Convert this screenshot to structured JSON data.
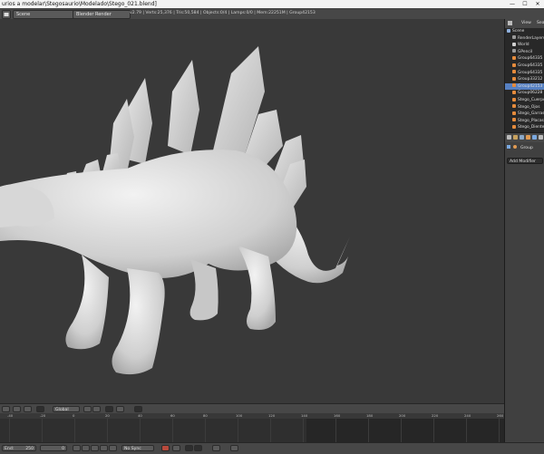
{
  "window": {
    "title": "urios a modelar\\Stegosaurio\\Modelado\\Stego_021.blend]",
    "controls": [
      "—",
      "☐",
      "✕"
    ]
  },
  "topbar": {
    "scene": "Scene",
    "render_engine": "Blender Render",
    "stats": "v2.79 | Verts:25,376 | Tris:50,584 | Objects:0/4 | Lamps:0/0 | Mem:22251M | Group42153"
  },
  "outliner": {
    "headers": [
      "View",
      "Search"
    ],
    "items": [
      {
        "label": "Scene",
        "color": "#8fb0dd"
      },
      {
        "label": "RenderLayers",
        "color": "#9a9a9a"
      },
      {
        "label": "World",
        "color": "#d0d0d0"
      },
      {
        "label": "GPencil",
        "color": "#9a9a9a"
      },
      {
        "label": "Group64335",
        "color": "#e58b3c"
      },
      {
        "label": "Group64335",
        "color": "#e58b3c"
      },
      {
        "label": "Group64335",
        "color": "#e58b3c"
      },
      {
        "label": "Group33212",
        "color": "#e58b3c"
      },
      {
        "label": "Group42153",
        "color": "#e58b3c",
        "selected": true
      },
      {
        "label": "Group06228",
        "color": "#e58b3c"
      },
      {
        "label": "Stego_Cuerpo",
        "color": "#e58b3c"
      },
      {
        "label": "Stego_Ojos",
        "color": "#e58b3c"
      },
      {
        "label": "Stego_Garras",
        "color": "#e58b3c"
      },
      {
        "label": "Stego_Placas",
        "color": "#e58b3c"
      },
      {
        "label": "Stego_Dientes",
        "color": "#e58b3c"
      }
    ]
  },
  "properties": {
    "object_name": "Group",
    "add_modifier": "Add Modifier"
  },
  "viewport_header": {
    "orientation": "Global"
  },
  "timeline": {
    "ticks": [
      "-40",
      "-20",
      "0",
      "20",
      "40",
      "60",
      "80",
      "100",
      "120",
      "140",
      "160",
      "180",
      "200",
      "220",
      "240",
      "260"
    ]
  },
  "bottombar": {
    "end_label": "End:",
    "end_value": "250",
    "current_frame": "0",
    "sync": "No Sync"
  }
}
